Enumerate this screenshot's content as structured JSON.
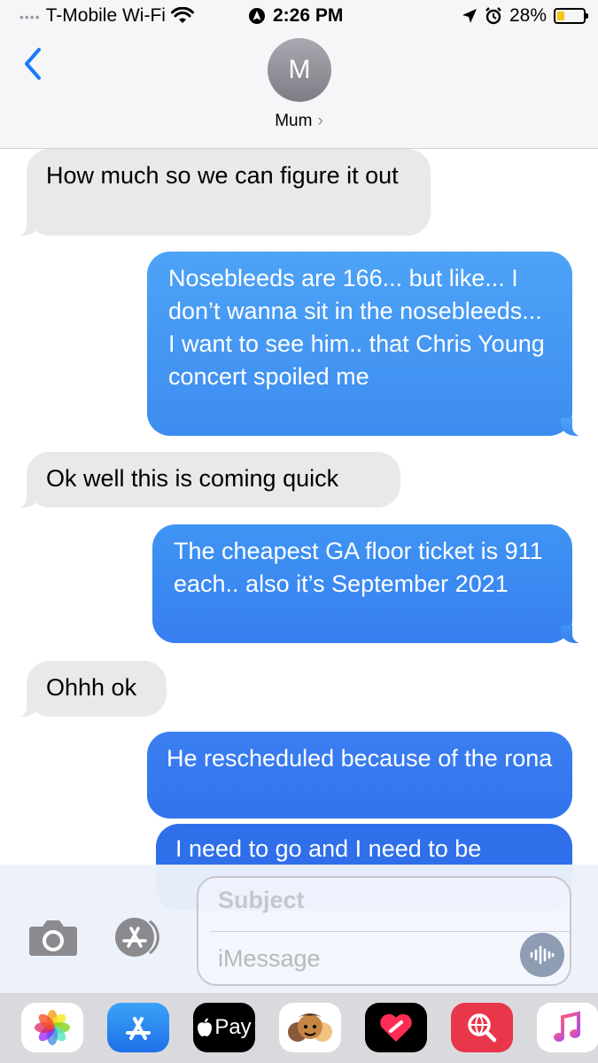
{
  "status_bar": {
    "carrier": "T-Mobile Wi-Fi",
    "time": "2:26 PM",
    "battery": "28%",
    "battery_level": 0.28
  },
  "header": {
    "avatar_initial": "M",
    "contact_name": "Mum",
    "chevron": "›"
  },
  "messages": [
    {
      "direction": "incoming",
      "text": "How much so we can figure it out"
    },
    {
      "direction": "outgoing",
      "text": "Nosebleeds are 166... but like... I don’t wanna sit in the nosebleeds... I want to see him.. that Chris Young concert spoiled me"
    },
    {
      "direction": "incoming",
      "text": "Ok well this is coming quick"
    },
    {
      "direction": "outgoing",
      "text": "The cheapest GA floor ticket is 911 each.. also it’s September 2021"
    },
    {
      "direction": "incoming",
      "text": "Ohhh ok"
    },
    {
      "direction": "outgoing",
      "text": "He rescheduled because of the rona"
    },
    {
      "direction": "outgoing",
      "text": "I need to go and I need to be"
    }
  ],
  "compose": {
    "subject_placeholder": "Subject",
    "message_placeholder": "iMessage"
  },
  "app_drawer": {
    "apps": [
      "photos-icon",
      "app-store-icon",
      "apple-pay-icon",
      "memoji-icon",
      "digital-touch-icon",
      "search-images-icon",
      "music-icon"
    ],
    "apple_pay_label": "Pay"
  },
  "colors": {
    "incoming_bubble": "#e9e9eb",
    "outgoing_bubble_top": "#4aa0f5",
    "outgoing_bubble_bottom": "#2e6fe6",
    "accent": "#1a7cf5"
  }
}
